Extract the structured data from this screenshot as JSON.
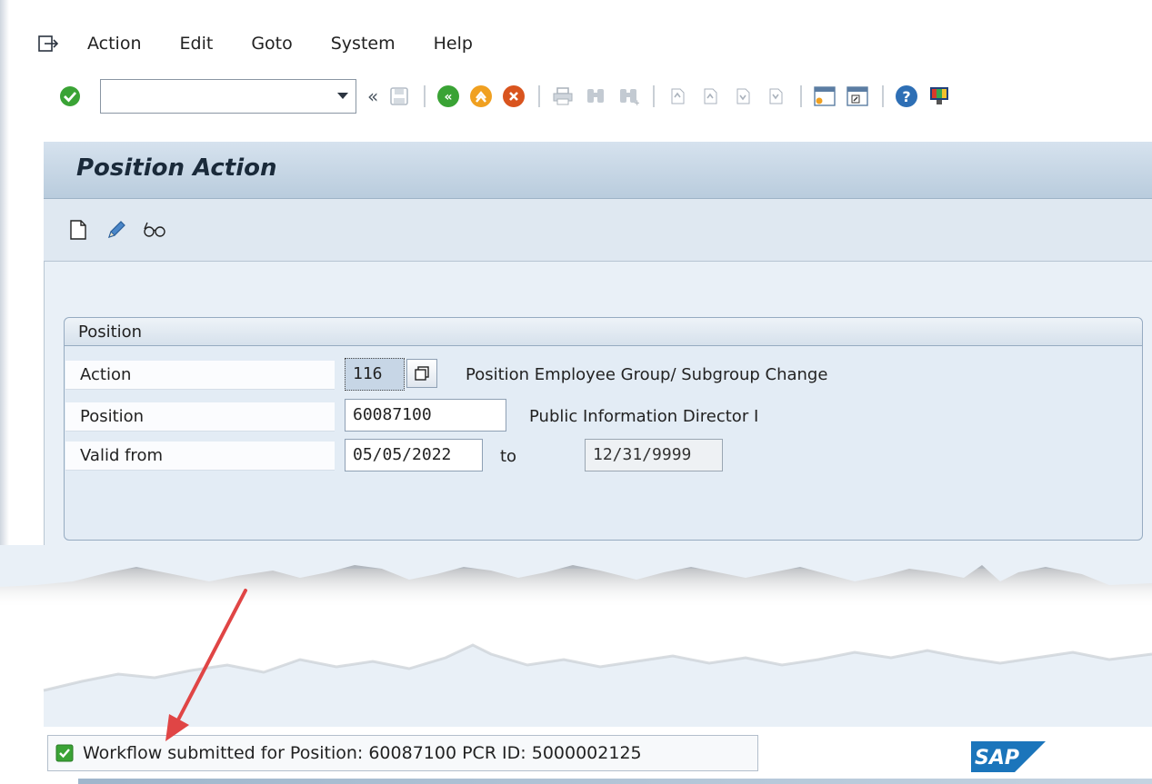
{
  "menu": {
    "items": [
      {
        "label": "Action"
      },
      {
        "label": "Edit"
      },
      {
        "label": "Goto"
      },
      {
        "label": "System"
      },
      {
        "label": "Help"
      }
    ]
  },
  "toolbar": {
    "command_field_value": "",
    "icons": [
      "enter-icon",
      "save-icon",
      "back-icon",
      "exit-icon",
      "cancel-icon",
      "print-icon",
      "find-icon",
      "find-next-icon",
      "first-page-icon",
      "previous-page-icon",
      "next-page-icon",
      "last-page-icon",
      "create-session-icon",
      "shortcut-icon",
      "help-icon",
      "customize-layout-icon"
    ]
  },
  "page": {
    "title": "Position Action"
  },
  "app_toolbar": {
    "icons": [
      "create-icon",
      "change-icon",
      "display-icon"
    ]
  },
  "position_group": {
    "title": "Position",
    "action_label": "Action",
    "action_value": "116",
    "action_text": "Position Employee Group/ Subgroup Change",
    "position_label": "Position",
    "position_value": "60087100",
    "position_text": "Public Information Director I",
    "valid_from_label": "Valid from",
    "valid_from_value": "05/05/2022",
    "to_label": "to",
    "valid_to_value": "12/31/9999"
  },
  "status": {
    "message": "Workflow submitted for Position: 60087100  PCR ID: 5000002125"
  },
  "brand": {
    "logo_text": "SAP"
  },
  "colors": {
    "accent_green": "#3aa335",
    "back_orange": "#f0a020",
    "cancel_red": "#d9541e",
    "arrow_red": "#e04545",
    "sap_blue": "#1b75bb"
  }
}
